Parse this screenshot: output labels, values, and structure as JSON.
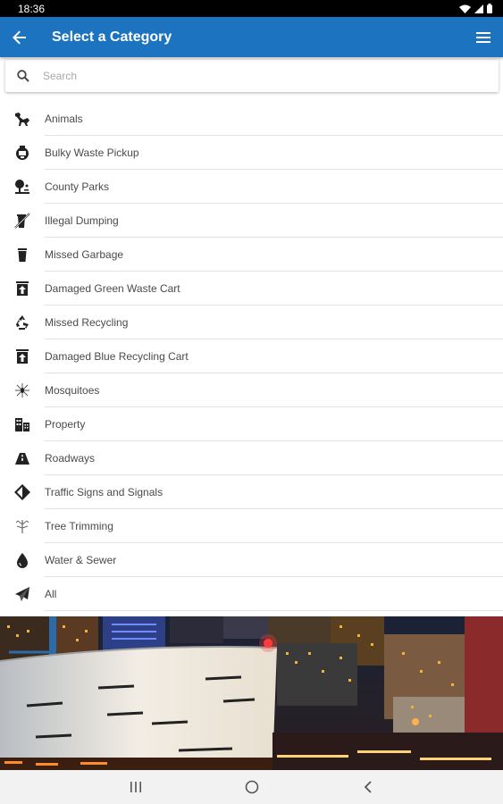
{
  "status_bar": {
    "time": "18:36"
  },
  "header": {
    "title": "Select a Category",
    "back_icon": "arrow-left-icon",
    "menu_icon": "hamburger-menu-icon"
  },
  "search": {
    "placeholder": "Search",
    "value": ""
  },
  "categories": [
    {
      "label": "Animals",
      "icon": "animal-icon"
    },
    {
      "label": "Bulky Waste Pickup",
      "icon": "bulky-waste-icon"
    },
    {
      "label": "County Parks",
      "icon": "park-icon"
    },
    {
      "label": "Illegal Dumping",
      "icon": "dumping-icon"
    },
    {
      "label": "Missed Garbage",
      "icon": "garbage-can-icon"
    },
    {
      "label": "Damaged Green Waste Cart",
      "icon": "waste-cart-icon"
    },
    {
      "label": "Missed Recycling",
      "icon": "recycle-icon"
    },
    {
      "label": "Damaged Blue Recycling Cart",
      "icon": "recycling-cart-icon"
    },
    {
      "label": "Mosquitoes",
      "icon": "mosquito-icon"
    },
    {
      "label": "Property",
      "icon": "building-icon"
    },
    {
      "label": "Roadways",
      "icon": "road-icon"
    },
    {
      "label": "Traffic Signs and Signals",
      "icon": "traffic-sign-icon"
    },
    {
      "label": "Tree Trimming",
      "icon": "tree-icon"
    },
    {
      "label": "Water & Sewer",
      "icon": "water-drop-icon"
    },
    {
      "label": "All",
      "icon": "paper-plane-icon"
    }
  ],
  "colors": {
    "app_bar": "#1c73c0",
    "status_bar": "#000000",
    "nav_bar": "#f2f2f2"
  }
}
